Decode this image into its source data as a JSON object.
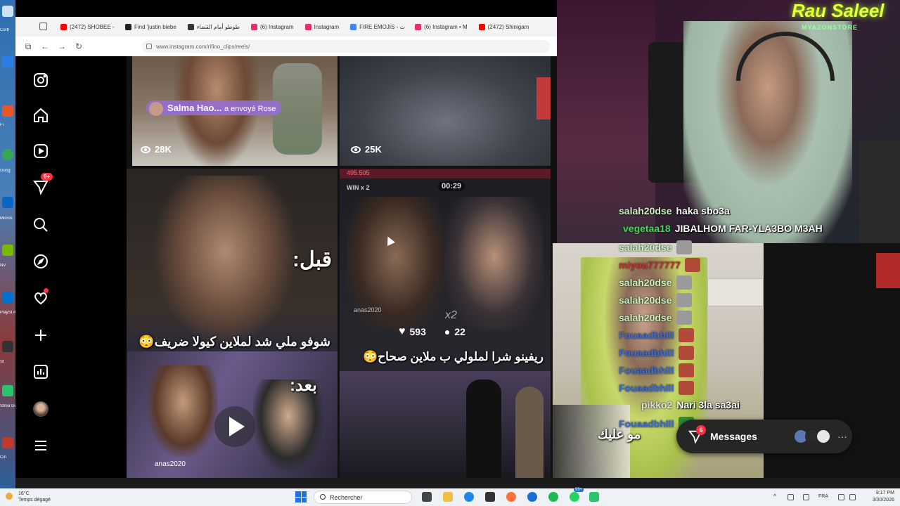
{
  "browser": {
    "tabs": [
      {
        "label": "(2472) SHOBEE -",
        "fav_color": "#ff0000"
      },
      {
        "label": "Find 'justin biebe",
        "fav_color": "#222222"
      },
      {
        "label": "طوطو أمام القضاء",
        "fav_color": "#333333"
      },
      {
        "label": "(6) Instagram",
        "fav_color": "#e1306c"
      },
      {
        "label": "Instagram",
        "fav_color": "#e1306c"
      },
      {
        "label": "FIRE EMOJIS - ث",
        "fav_color": "#4285f4"
      },
      {
        "label": "(6) Instagram • M",
        "fav_color": "#e1306c"
      },
      {
        "label": "(2472) Shinigam",
        "fav_color": "#ff0000"
      }
    ],
    "url": "www.instagram.com/rifino_clips/reels/"
  },
  "ig_sidebar": {
    "items": [
      {
        "name": "instagram-logo-icon"
      },
      {
        "name": "home-icon"
      },
      {
        "name": "reels-icon"
      },
      {
        "name": "direct-messages-icon",
        "badge": "9+"
      },
      {
        "name": "search-icon"
      },
      {
        "name": "explore-icon"
      },
      {
        "name": "notifications-heart-icon"
      },
      {
        "name": "create-plus-icon"
      },
      {
        "name": "dashboard-icon"
      },
      {
        "name": "profile-avatar"
      },
      {
        "name": "more-menu-icon"
      }
    ]
  },
  "reels": {
    "r1": {
      "views": "28K",
      "pill_name": "Salma Hao...",
      "pill_suffix": "a envoyé Rose"
    },
    "r2": {
      "views": "25K"
    },
    "r3": {
      "top_text": "قبل:",
      "caption": "شوفو ملي شد لملاين كيولا ضريف😳",
      "bottom_text": "بعد:",
      "watermark": "anas2020"
    },
    "r4": {
      "header_num": "495.505",
      "timer": "00:29",
      "win": "WIN x 2",
      "likes": "593",
      "comments": "22",
      "caption": "ريفينو شرا لملولي ب ملاين صحاح😳",
      "user": "anas2020",
      "x2": "x2"
    }
  },
  "stream": {
    "neon_title": "Rau Saleel",
    "neon_sub": "MYAZONSTORE",
    "chat": [
      {
        "user": "salah20dse",
        "color": "#c7f0c0",
        "msg": "haka sbo3a",
        "emote": ""
      },
      {
        "user": "vegetaa18",
        "color": "#3ddc5a",
        "msg": "JIBALHOM FAR-YLA3BO M3AH",
        "emote": ""
      },
      {
        "user": "salah20dse",
        "color": "#c7f0c0",
        "msg": "",
        "emote": "#9a9a9a"
      },
      {
        "user": "miyou777777",
        "color": "#d42b2b",
        "msg": "",
        "emote": "#b24a3a"
      },
      {
        "user": "salah20dse",
        "color": "#c7f0c0",
        "msg": "",
        "emote": "#9a9a9a"
      },
      {
        "user": "salah20dse",
        "color": "#c7f0c0",
        "msg": "",
        "emote": "#9a9a9a"
      },
      {
        "user": "salah20dse",
        "color": "#c7f0c0",
        "msg": "",
        "emote": "#9a9a9a"
      },
      {
        "user": "Fouaadbhlll",
        "color": "#3a6de0",
        "msg": "",
        "emote": "#b24a3a"
      },
      {
        "user": "Fouaadbhlll",
        "color": "#3a6de0",
        "msg": "",
        "emote": "#b24a3a"
      },
      {
        "user": "Fouaadbhlll",
        "color": "#3a6de0",
        "msg": "",
        "emote": "#b24a3a"
      },
      {
        "user": "Fouaadbhlll",
        "color": "#3a6de0",
        "msg": "",
        "emote": "#b24a3a"
      },
      {
        "user": "pikko2",
        "color": "#e0e0e0",
        "msg": "Nari 3la sa3ai",
        "emote": ""
      },
      {
        "user": "Fouaadbhlll",
        "color": "#3a6de0",
        "msg": "",
        "emote": "#2e8b3a"
      }
    ],
    "guest_caption": "مو عليك"
  },
  "messages_bar": {
    "label": "Messages",
    "badge": "6"
  },
  "taskbar": {
    "weather_temp": "16°C",
    "weather_desc": "Temps dégagé",
    "search_placeholder": "Rechercher",
    "lang": "FRA",
    "time": "9:17 PM",
    "date": "3/30/2026",
    "whatsapp_badge": "99+"
  },
  "desktop": {
    "labels": [
      "Corb",
      "Fi",
      "Goog",
      "Micros",
      "NV",
      "PlaySt Acce",
      "St",
      "Strea De",
      "Cin"
    ]
  }
}
